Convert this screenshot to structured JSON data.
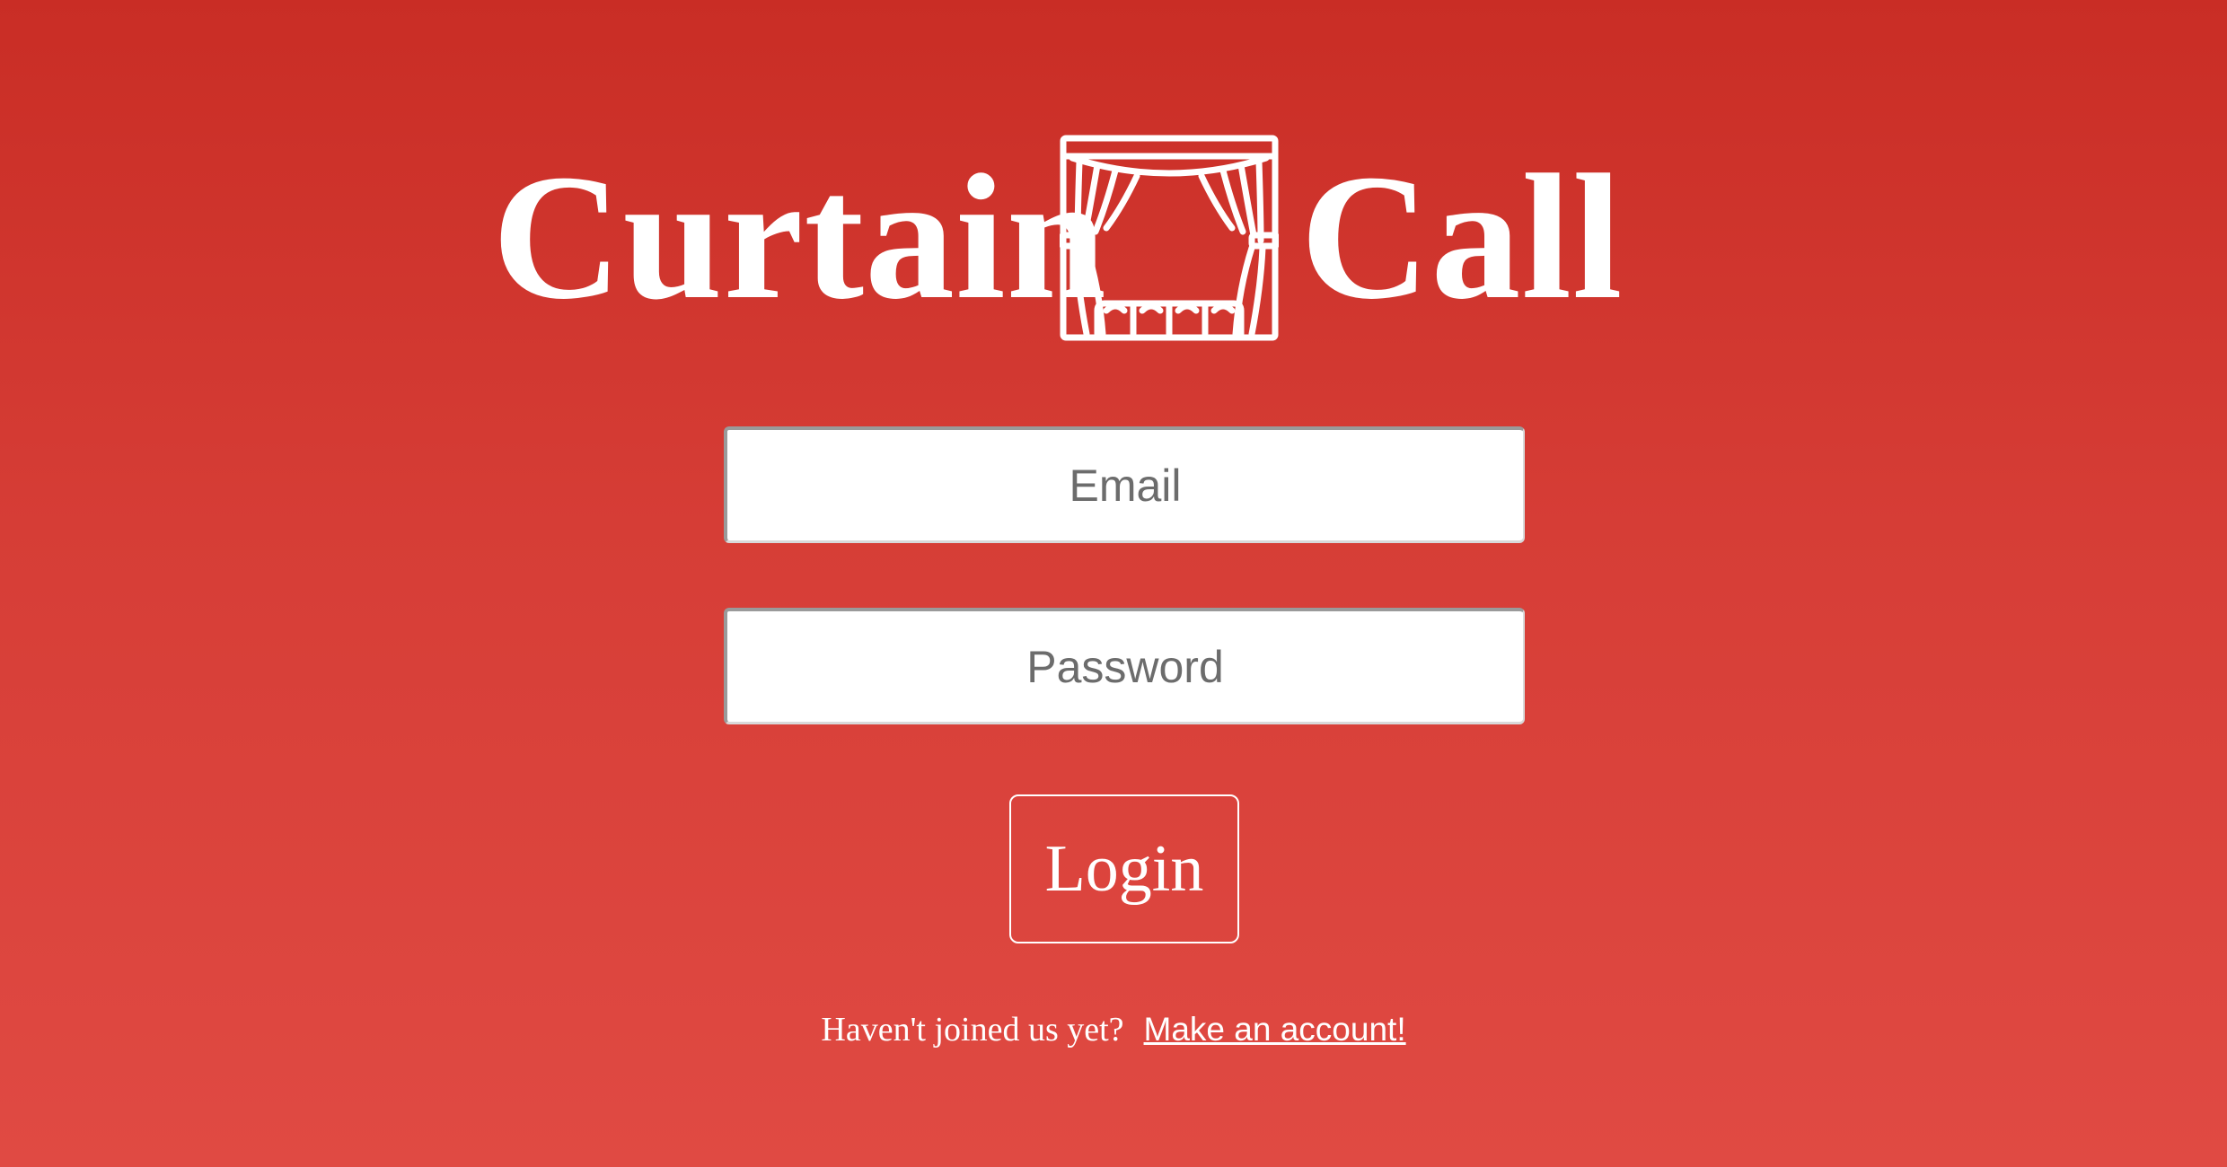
{
  "brand": {
    "word_left": "Curtain",
    "word_right": "Call",
    "logo_icon": "theater-curtain-icon"
  },
  "form": {
    "email_placeholder": "Email",
    "password_placeholder": "Password",
    "login_label": "Login"
  },
  "signup": {
    "prompt": "Haven't joined us yet?",
    "link_label": "Make an account!"
  },
  "colors": {
    "background_top": "#c92d25",
    "background_bottom": "#e04a43",
    "foreground": "#ffffff"
  }
}
